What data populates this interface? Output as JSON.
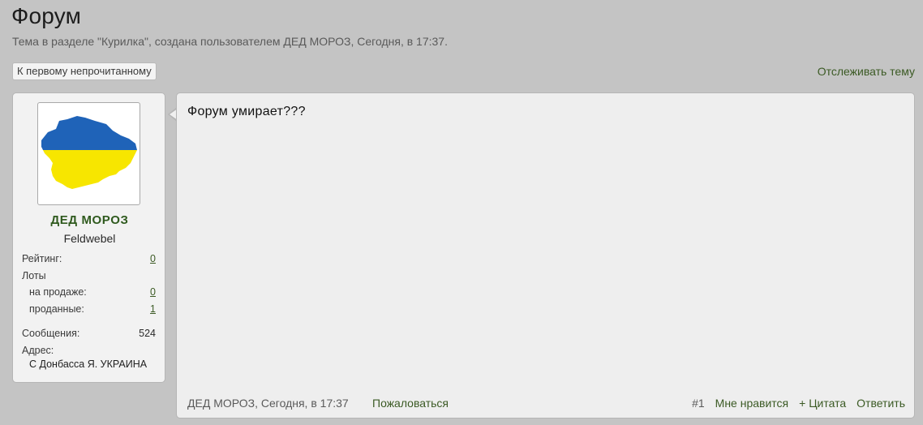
{
  "thread": {
    "title": "Форум",
    "subtitle": "Тема в разделе \"Курилка\", создана пользователем ДЕД МОРОЗ, Сегодня, в 17:37.",
    "first_unread_label": "К первому непрочитанному",
    "watch_label": "Отслеживать тему"
  },
  "user": {
    "avatar_icon": "crimea-map-avatar-icon",
    "avatar_colors": {
      "top": "#1f63b8",
      "bottom": "#f7e600"
    },
    "name": "ДЕД МОРОЗ",
    "rank": "Feldwebel",
    "rating_label": "Рейтинг:",
    "rating_value": "0",
    "lots_label": "Лоты",
    "on_sale_label": "на продаже:",
    "on_sale_value": "0",
    "sold_label": "проданные:",
    "sold_value": "1",
    "messages_label": "Сообщения:",
    "messages_value": "524",
    "address_label": "Адрес:",
    "address_value": "С Донбасса Я. УКРАИНА"
  },
  "post": {
    "text": "Форум умирает???",
    "author_time": "ДЕД МОРОЗ, Сегодня, в 17:37",
    "report_label": "Пожаловаться",
    "number": "#1",
    "like_label": "Мне нравится",
    "quote_label": "+ Цитата",
    "reply_label": "Ответить"
  }
}
